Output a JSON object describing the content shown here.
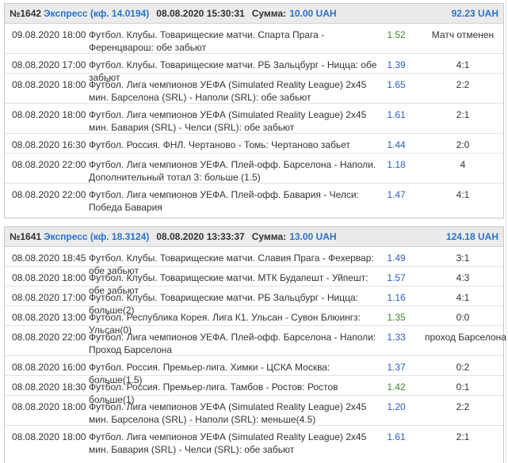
{
  "coupons": [
    {
      "number": "№1642",
      "type": "Экспресс (кф. 14.0194)",
      "datetime": "08.08.2020 15:30:31",
      "sum_label": "Сумма:",
      "sum_value": "10.00 UAH",
      "win": "92.23 UAH",
      "rows": [
        {
          "date": "09.08.2020 18:00",
          "event": "Футбол. Клубы. Товарищеские матчи. Спарта Прага - Ференцварош: обе забьют",
          "odds": "1.52",
          "odds_color": "green",
          "result": "Матч отменен"
        },
        {
          "date": "08.08.2020 17:00",
          "event": "Футбол. Клубы. Товарищеские матчи. РБ Зальцбург - Ницца: обе забьют",
          "odds": "1.39",
          "odds_color": "blue",
          "result": "4:1"
        },
        {
          "date": "08.08.2020 18:00",
          "event": "Футбол. Лига чемпионов УЕФА (Simulated Reality League) 2x45 мин. Барселона (SRL) - Наполи (SRL): обе забьют",
          "odds": "1.65",
          "odds_color": "blue",
          "result": "2:2"
        },
        {
          "date": "08.08.2020 18:00",
          "event": "Футбол. Лига чемпионов УЕФА (Simulated Reality League) 2x45 мин. Бавария (SRL) - Челси (SRL): обе забьют",
          "odds": "1.61",
          "odds_color": "blue",
          "result": "2:1"
        },
        {
          "date": "08.08.2020 16:30",
          "event": "Футбол. Россия. ФНЛ. Чертаново - Томь: Чертаново забьет",
          "odds": "1.44",
          "odds_color": "blue",
          "result": "2:0"
        },
        {
          "date": "08.08.2020 22:00",
          "event": "Футбол. Лига чемпионов УЕФА. Плей-офф. Барселона - Наполи. Дополнительный тотал 3: больше (1.5)",
          "odds": "1.18",
          "odds_color": "blue",
          "result": "4"
        },
        {
          "date": "08.08.2020 22:00",
          "event": "Футбол. Лига чемпионов УЕФА. Плей-офф. Бавария - Челси: Победа Бавария",
          "odds": "1.47",
          "odds_color": "blue",
          "result": "4:1"
        }
      ]
    },
    {
      "number": "№1641",
      "type": "Экспресс (кф. 18.3124)",
      "datetime": "08.08.2020 13:33:37",
      "sum_label": "Сумма:",
      "sum_value": "13.00 UAH",
      "win": "124.18 UAH",
      "rows": [
        {
          "date": "08.08.2020 18:45",
          "event": "Футбол. Клубы. Товарищеские матчи. Славия Прага - Фехервар: обе забьют",
          "odds": "1.49",
          "odds_color": "blue",
          "result": "3:1"
        },
        {
          "date": "08.08.2020 18:00",
          "event": "Футбол. Клубы. Товарищеские матчи. МТК Будапешт - Уйпешт: обе забьют",
          "odds": "1.57",
          "odds_color": "blue",
          "result": "4:3"
        },
        {
          "date": "08.08.2020 17:00",
          "event": "Футбол. Клубы. Товарищеские матчи. РБ Зальцбург - Ницца: больше(2)",
          "odds": "1.16",
          "odds_color": "blue",
          "result": "4:1"
        },
        {
          "date": "08.08.2020 13:00",
          "event": "Футбол. Республика Корея. Лига К1. Ульсан - Сувон Блюингз: Ульсан(0)",
          "odds": "1.35",
          "odds_color": "green",
          "result": "0:0"
        },
        {
          "date": "08.08.2020 22:00",
          "event": "Футбол. Лига чемпионов УЕФА. Плей-офф. Барселона - Наполи: Проход Барселона",
          "odds": "1.33",
          "odds_color": "blue",
          "result": "проход Барселона"
        },
        {
          "date": "08.08.2020 16:00",
          "event": "Футбол. Россия. Премьер-лига. Химки - ЦСКА Москва: больше(1.5)",
          "odds": "1.37",
          "odds_color": "blue",
          "result": "0:2"
        },
        {
          "date": "08.08.2020 18:30",
          "event": "Футбол. Россия. Премьер-лига. Тамбов - Ростов: Ростов больше(1)",
          "odds": "1.42",
          "odds_color": "green",
          "result": "0:1"
        },
        {
          "date": "08.08.2020 18:00",
          "event": "Футбол. Лига чемпионов УЕФА (Simulated Reality League) 2x45 мин. Барселона (SRL) - Наполи (SRL): меньше(4.5)",
          "odds": "1.20",
          "odds_color": "blue",
          "result": "2:2"
        },
        {
          "date": "08.08.2020 18:00",
          "event": "Футбол. Лига чемпионов УЕФА (Simulated Reality League) 2x45 мин. Бавария (SRL) - Челси (SRL): обе забьют",
          "odds": "1.61",
          "odds_color": "blue",
          "result": "2:1"
        }
      ]
    }
  ]
}
